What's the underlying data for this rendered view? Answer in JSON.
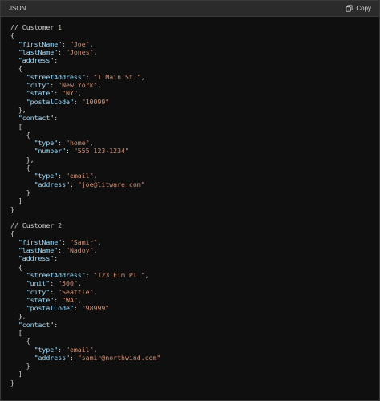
{
  "header": {
    "title": "JSON",
    "copy_label": "Copy"
  },
  "code_lines": [
    [
      {
        "t": "// Customer ",
        "c": "c"
      },
      {
        "t": "1",
        "c": "num"
      }
    ],
    [
      {
        "t": "{",
        "c": "p"
      }
    ],
    [
      {
        "t": "  ",
        "c": "p"
      },
      {
        "t": "\"firstName\"",
        "c": "k"
      },
      {
        "t": ": ",
        "c": "p"
      },
      {
        "t": "\"Joe\"",
        "c": "s"
      },
      {
        "t": ",",
        "c": "p"
      }
    ],
    [
      {
        "t": "  ",
        "c": "p"
      },
      {
        "t": "\"lastName\"",
        "c": "k"
      },
      {
        "t": ": ",
        "c": "p"
      },
      {
        "t": "\"Jones\"",
        "c": "s"
      },
      {
        "t": ",",
        "c": "p"
      }
    ],
    [
      {
        "t": "  ",
        "c": "p"
      },
      {
        "t": "\"address\"",
        "c": "k"
      },
      {
        "t": ":",
        "c": "p"
      }
    ],
    [
      {
        "t": "  {",
        "c": "p"
      }
    ],
    [
      {
        "t": "    ",
        "c": "p"
      },
      {
        "t": "\"streetAddress\"",
        "c": "k"
      },
      {
        "t": ": ",
        "c": "p"
      },
      {
        "t": "\"1 Main St.\"",
        "c": "s"
      },
      {
        "t": ",",
        "c": "p"
      }
    ],
    [
      {
        "t": "    ",
        "c": "p"
      },
      {
        "t": "\"city\"",
        "c": "k"
      },
      {
        "t": ": ",
        "c": "p"
      },
      {
        "t": "\"New York\"",
        "c": "s"
      },
      {
        "t": ",",
        "c": "p"
      }
    ],
    [
      {
        "t": "    ",
        "c": "p"
      },
      {
        "t": "\"state\"",
        "c": "k"
      },
      {
        "t": ": ",
        "c": "p"
      },
      {
        "t": "\"NY\"",
        "c": "s"
      },
      {
        "t": ",",
        "c": "p"
      }
    ],
    [
      {
        "t": "    ",
        "c": "p"
      },
      {
        "t": "\"postalCode\"",
        "c": "k"
      },
      {
        "t": ": ",
        "c": "p"
      },
      {
        "t": "\"10099\"",
        "c": "s"
      }
    ],
    [
      {
        "t": "  },",
        "c": "p"
      }
    ],
    [
      {
        "t": "  ",
        "c": "p"
      },
      {
        "t": "\"contact\"",
        "c": "k"
      },
      {
        "t": ":",
        "c": "p"
      }
    ],
    [
      {
        "t": "  [",
        "c": "p"
      }
    ],
    [
      {
        "t": "    {",
        "c": "p"
      }
    ],
    [
      {
        "t": "      ",
        "c": "p"
      },
      {
        "t": "\"type\"",
        "c": "k"
      },
      {
        "t": ": ",
        "c": "p"
      },
      {
        "t": "\"home\"",
        "c": "s"
      },
      {
        "t": ",",
        "c": "p"
      }
    ],
    [
      {
        "t": "      ",
        "c": "p"
      },
      {
        "t": "\"number\"",
        "c": "k"
      },
      {
        "t": ": ",
        "c": "p"
      },
      {
        "t": "\"555 123-1234\"",
        "c": "s"
      }
    ],
    [
      {
        "t": "    },",
        "c": "p"
      }
    ],
    [
      {
        "t": "    {",
        "c": "p"
      }
    ],
    [
      {
        "t": "      ",
        "c": "p"
      },
      {
        "t": "\"type\"",
        "c": "k"
      },
      {
        "t": ": ",
        "c": "p"
      },
      {
        "t": "\"email\"",
        "c": "s"
      },
      {
        "t": ",",
        "c": "p"
      }
    ],
    [
      {
        "t": "      ",
        "c": "p"
      },
      {
        "t": "\"address\"",
        "c": "k"
      },
      {
        "t": ": ",
        "c": "p"
      },
      {
        "t": "\"joe@litware.com\"",
        "c": "s"
      }
    ],
    [
      {
        "t": "    }",
        "c": "p"
      }
    ],
    [
      {
        "t": "  ]",
        "c": "p"
      }
    ],
    [
      {
        "t": "}",
        "c": "p"
      }
    ],
    [
      {
        "t": "",
        "c": "p"
      }
    ],
    [
      {
        "t": "// Customer ",
        "c": "c"
      },
      {
        "t": "2",
        "c": "num"
      }
    ],
    [
      {
        "t": "{",
        "c": "p"
      }
    ],
    [
      {
        "t": "  ",
        "c": "p"
      },
      {
        "t": "\"firstName\"",
        "c": "k"
      },
      {
        "t": ": ",
        "c": "p"
      },
      {
        "t": "\"Samir\"",
        "c": "s"
      },
      {
        "t": ",",
        "c": "p"
      }
    ],
    [
      {
        "t": "  ",
        "c": "p"
      },
      {
        "t": "\"lastName\"",
        "c": "k"
      },
      {
        "t": ": ",
        "c": "p"
      },
      {
        "t": "\"Nadoy\"",
        "c": "s"
      },
      {
        "t": ",",
        "c": "p"
      }
    ],
    [
      {
        "t": "  ",
        "c": "p"
      },
      {
        "t": "\"address\"",
        "c": "k"
      },
      {
        "t": ":",
        "c": "p"
      }
    ],
    [
      {
        "t": "  {",
        "c": "p"
      }
    ],
    [
      {
        "t": "    ",
        "c": "p"
      },
      {
        "t": "\"streetAddress\"",
        "c": "k"
      },
      {
        "t": ": ",
        "c": "p"
      },
      {
        "t": "\"123 Elm Pl.\"",
        "c": "s"
      },
      {
        "t": ",",
        "c": "p"
      }
    ],
    [
      {
        "t": "    ",
        "c": "p"
      },
      {
        "t": "\"unit\"",
        "c": "k"
      },
      {
        "t": ": ",
        "c": "p"
      },
      {
        "t": "\"500\"",
        "c": "s"
      },
      {
        "t": ",",
        "c": "p"
      }
    ],
    [
      {
        "t": "    ",
        "c": "p"
      },
      {
        "t": "\"city\"",
        "c": "k"
      },
      {
        "t": ": ",
        "c": "p"
      },
      {
        "t": "\"Seattle\"",
        "c": "s"
      },
      {
        "t": ",",
        "c": "p"
      }
    ],
    [
      {
        "t": "    ",
        "c": "p"
      },
      {
        "t": "\"state\"",
        "c": "k"
      },
      {
        "t": ": ",
        "c": "p"
      },
      {
        "t": "\"WA\"",
        "c": "s"
      },
      {
        "t": ",",
        "c": "p"
      }
    ],
    [
      {
        "t": "    ",
        "c": "p"
      },
      {
        "t": "\"postalCode\"",
        "c": "k"
      },
      {
        "t": ": ",
        "c": "p"
      },
      {
        "t": "\"98999\"",
        "c": "s"
      }
    ],
    [
      {
        "t": "  },",
        "c": "p"
      }
    ],
    [
      {
        "t": "  ",
        "c": "p"
      },
      {
        "t": "\"contact\"",
        "c": "k"
      },
      {
        "t": ":",
        "c": "p"
      }
    ],
    [
      {
        "t": "  [",
        "c": "p"
      }
    ],
    [
      {
        "t": "    {",
        "c": "p"
      }
    ],
    [
      {
        "t": "      ",
        "c": "p"
      },
      {
        "t": "\"type\"",
        "c": "k"
      },
      {
        "t": ": ",
        "c": "p"
      },
      {
        "t": "\"email\"",
        "c": "s"
      },
      {
        "t": ",",
        "c": "p"
      }
    ],
    [
      {
        "t": "      ",
        "c": "p"
      },
      {
        "t": "\"address\"",
        "c": "k"
      },
      {
        "t": ": ",
        "c": "p"
      },
      {
        "t": "\"samir@northwind.com\"",
        "c": "s"
      }
    ],
    [
      {
        "t": "    }",
        "c": "p"
      }
    ],
    [
      {
        "t": "  ]",
        "c": "p"
      }
    ],
    [
      {
        "t": "}",
        "c": "p"
      }
    ]
  ]
}
